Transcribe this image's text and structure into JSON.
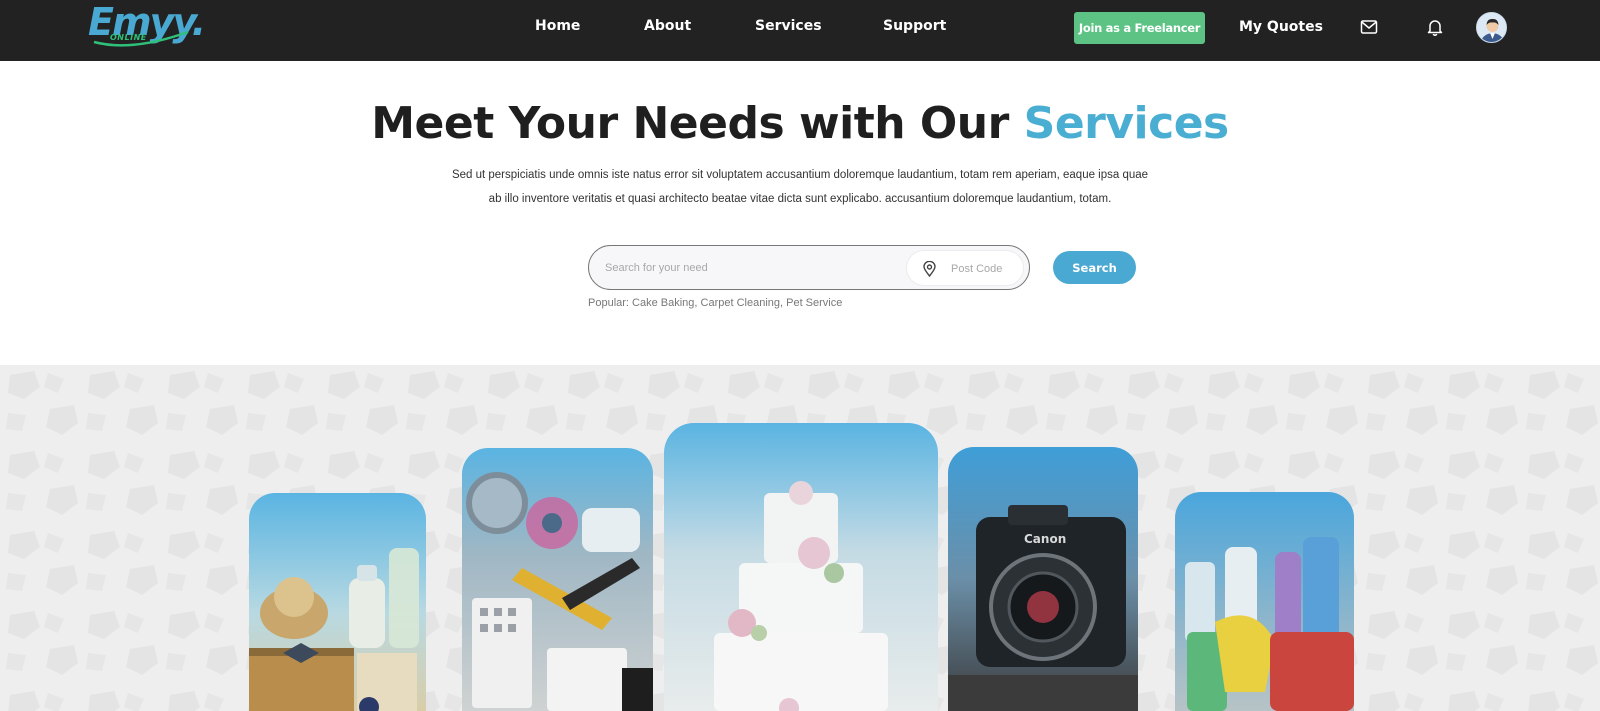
{
  "header": {
    "logo_text": "Emyy.",
    "logo_subtext": "ONLINE",
    "nav": [
      {
        "label": "Home"
      },
      {
        "label": "About"
      },
      {
        "label": "Services"
      },
      {
        "label": "Support"
      }
    ],
    "join_button": "Join as a Freelancer",
    "quotes_link": "My Quotes",
    "icons": [
      "mail-icon",
      "bell-icon",
      "avatar"
    ]
  },
  "hero": {
    "title_main": "Meet Your Needs with Our ",
    "title_accent": "Services",
    "description": "Sed ut perspiciatis unde omnis iste natus error sit voluptatem accusantium doloremque laudantium, totam rem aperiam, eaque ipsa quae ab illo inventore veritatis et quasi architecto beatae vitae dicta sunt explicabo. accusantium doloremque laudantium, totam."
  },
  "search": {
    "placeholder": "Search for your need",
    "postcode_placeholder": "Post Code",
    "button_label": "Search",
    "popular": "Popular: Cake Baking, Carpet Cleaning, Pet Service"
  },
  "gallery": {
    "cards": [
      "baby-products",
      "electrical-tools",
      "wedding-cake",
      "camera",
      "cleaning-supplies"
    ]
  },
  "colors": {
    "navbar": "#222222",
    "accent": "#4aaed3",
    "join_button": "#5cc385",
    "search_button": "#4aa9d2",
    "gallery_bg": "#eeeeee"
  }
}
